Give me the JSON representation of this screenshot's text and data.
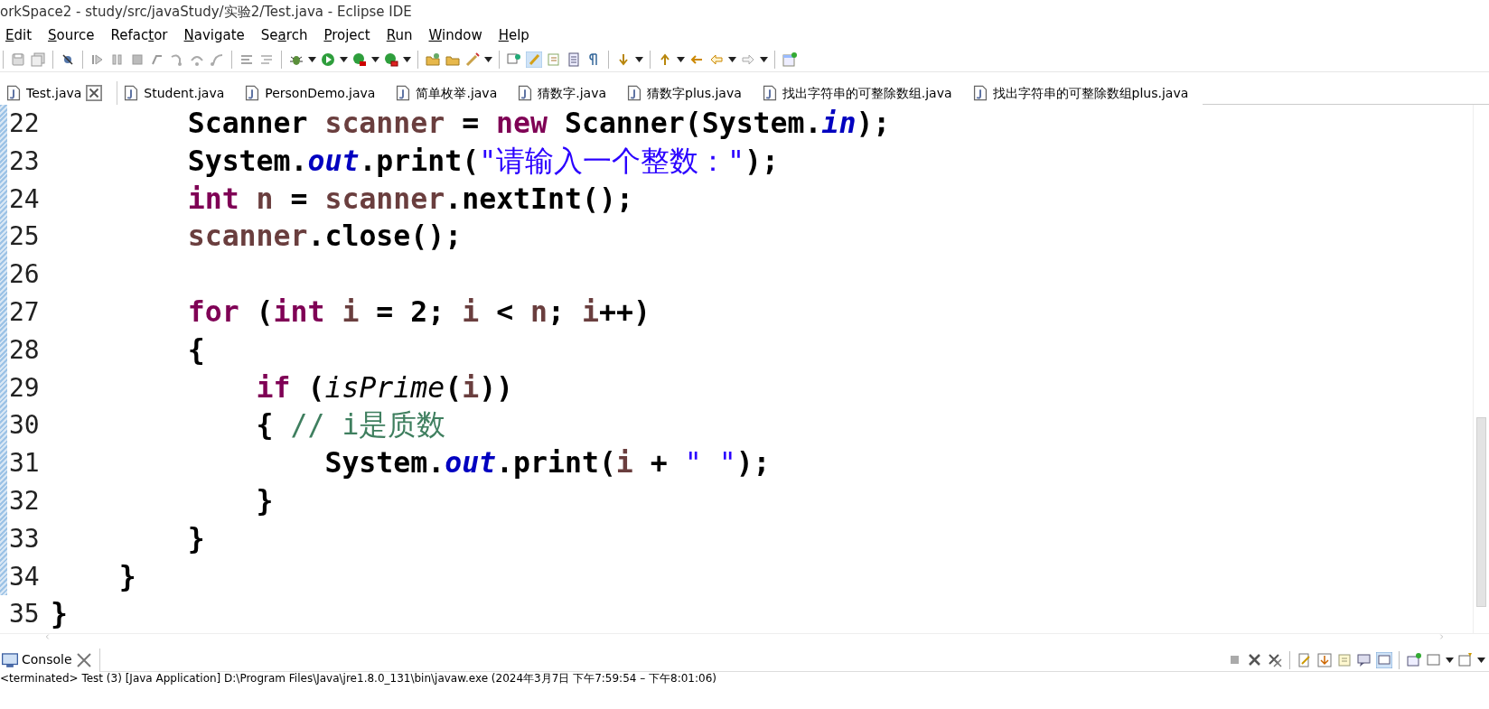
{
  "window": {
    "title": "orkSpace2 - study/src/javaStudy/实验2/Test.java - Eclipse IDE"
  },
  "menu": [
    {
      "key": "E",
      "after": "dit"
    },
    {
      "key": "S",
      "after": "ource"
    },
    {
      "before": "Refac",
      "key": "t",
      "after": "or"
    },
    {
      "key": "N",
      "after": "avigate"
    },
    {
      "before": "Se",
      "key": "a",
      "after": "rch"
    },
    {
      "key": "P",
      "after": "roject"
    },
    {
      "key": "R",
      "after": "un"
    },
    {
      "key": "W",
      "after": "indow"
    },
    {
      "key": "H",
      "after": "elp"
    }
  ],
  "tabs": [
    {
      "label": "Test.java",
      "selected": true
    },
    {
      "label": "Student.java",
      "selected": false
    },
    {
      "label": "PersonDemo.java",
      "selected": false
    },
    {
      "label": "简单枚举.java",
      "selected": false
    },
    {
      "label": "猜数字.java",
      "selected": false
    },
    {
      "label": "猜数字plus.java",
      "selected": false
    },
    {
      "label": "找出字符串的可整除数组.java",
      "selected": false
    },
    {
      "label": "找出字符串的可整除数组plus.java",
      "selected": false
    }
  ],
  "editor": {
    "lines": [
      {
        "number": "22",
        "segments": [
          {
            "kind": "plain",
            "text": "        Scanner "
          },
          {
            "kind": "local",
            "text": "scanner"
          },
          {
            "kind": "plain",
            "text": " = "
          },
          {
            "kind": "keyword",
            "text": "new"
          },
          {
            "kind": "plain",
            "text": " Scanner(System."
          },
          {
            "kind": "field",
            "text": "in"
          },
          {
            "kind": "plain",
            "text": ");"
          }
        ]
      },
      {
        "number": "23",
        "segments": [
          {
            "kind": "plain",
            "text": "        System."
          },
          {
            "kind": "field",
            "text": "out"
          },
          {
            "kind": "plain",
            "text": ".print("
          },
          {
            "kind": "string",
            "text": "\"请输入一个整数：\""
          },
          {
            "kind": "plain",
            "text": ");"
          }
        ]
      },
      {
        "number": "24",
        "segments": [
          {
            "kind": "keyword",
            "text": "        int"
          },
          {
            "kind": "local",
            "text": " n"
          },
          {
            "kind": "plain",
            "text": " = "
          },
          {
            "kind": "local",
            "text": "scanner"
          },
          {
            "kind": "plain",
            "text": ".nextInt();"
          }
        ]
      },
      {
        "number": "25",
        "segments": [
          {
            "kind": "local",
            "text": "        scanner"
          },
          {
            "kind": "plain",
            "text": ".close();"
          }
        ]
      },
      {
        "number": "26"
      },
      {
        "number": "27",
        "segments": [
          {
            "kind": "keyword",
            "text": "        for"
          },
          {
            "kind": "plain",
            "text": " ("
          },
          {
            "kind": "keyword",
            "text": "int"
          },
          {
            "kind": "local",
            "text": " i"
          },
          {
            "kind": "plain",
            "text": " = 2; "
          },
          {
            "kind": "local",
            "text": "i"
          },
          {
            "kind": "plain",
            "text": " < "
          },
          {
            "kind": "local",
            "text": "n"
          },
          {
            "kind": "plain",
            "text": "; "
          },
          {
            "kind": "local",
            "text": "i"
          },
          {
            "kind": "plain",
            "text": "++)"
          }
        ]
      },
      {
        "number": "28",
        "segments": [
          {
            "kind": "plain",
            "text": "        {"
          }
        ]
      },
      {
        "number": "29",
        "segments": [
          {
            "kind": "keyword",
            "text": "            if"
          },
          {
            "kind": "plain",
            "text": " ("
          },
          {
            "kind": "static",
            "text": "isPrime"
          },
          {
            "kind": "plain",
            "text": "("
          },
          {
            "kind": "local",
            "text": "i"
          },
          {
            "kind": "plain",
            "text": "))"
          }
        ]
      },
      {
        "number": "30",
        "segments": [
          {
            "kind": "plain",
            "text": "            { "
          },
          {
            "kind": "comment",
            "text": "// i是质数"
          }
        ]
      },
      {
        "number": "31",
        "segments": [
          {
            "kind": "plain",
            "text": "                System."
          },
          {
            "kind": "field",
            "text": "out"
          },
          {
            "kind": "plain",
            "text": ".print("
          },
          {
            "kind": "local",
            "text": "i"
          },
          {
            "kind": "plain",
            "text": " + "
          },
          {
            "kind": "string",
            "text": "\" \""
          },
          {
            "kind": "plain",
            "text": ");"
          }
        ]
      },
      {
        "number": "32",
        "segments": [
          {
            "kind": "plain",
            "text": "            }"
          }
        ]
      },
      {
        "number": "33",
        "segments": [
          {
            "kind": "plain",
            "text": "        }"
          }
        ]
      },
      {
        "number": "34",
        "segments": [
          {
            "kind": "plain",
            "text": "    }"
          }
        ]
      },
      {
        "number": "35",
        "segments": [
          {
            "kind": "plain",
            "text": "}"
          }
        ]
      }
    ]
  },
  "console": {
    "title": "Console",
    "status": "<terminated> Test (3) [Java Application] D:\\Program Files\\Java\\jre1.8.0_131\\bin\\javaw.exe  (2024年3月7日 下午7:59:54 – 下午8:01:06)"
  }
}
